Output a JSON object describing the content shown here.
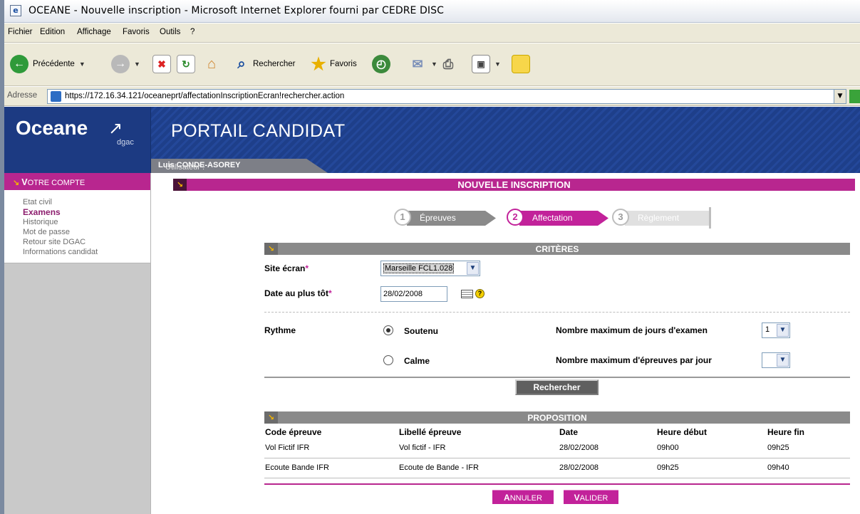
{
  "window": {
    "title": "OCEANE - Nouvelle inscription - Microsoft Internet Explorer fourni par CEDRE DISC"
  },
  "menu": [
    "Fichier",
    "Edition",
    "Affichage",
    "Favoris",
    "Outils",
    "?"
  ],
  "toolbar": {
    "back_label": "Précédente",
    "search_label": "Rechercher",
    "favorites_label": "Favoris"
  },
  "address": {
    "label": "Adresse",
    "url": "https://172.16.34.121/oceaneprt/affectationInscriptionEcran!rechercher.action"
  },
  "brand": {
    "name": "Oceane",
    "sub": "dgac",
    "portal_title": "PORTAIL CANDIDAT"
  },
  "user": {
    "prefix": "Utilisateur : ",
    "name": "Luis CONDE-ASOREY"
  },
  "sidebar": {
    "header_cap": "V",
    "header_rest": "OTRE COMPTE",
    "items": [
      "Etat civil",
      "Examens",
      "Historique",
      "Mot de passe",
      "Retour site DGAC",
      "Informations candidat"
    ]
  },
  "page": {
    "title": "NOUVELLE INSCRIPTION"
  },
  "steps": [
    {
      "num": "1",
      "label": "Épreuves"
    },
    {
      "num": "2",
      "label": "Affectation"
    },
    {
      "num": "3",
      "label": "Règlement"
    }
  ],
  "criteria": {
    "title": "CRITÈRES",
    "site_label": "Site écran",
    "site_value": "Marseille FCL1.028",
    "date_label": "Date au plus tôt",
    "date_value": "28/02/2008",
    "help": "?",
    "rythme_label": "Rythme",
    "rythme_options": [
      "Soutenu",
      "Calme"
    ],
    "max_days_label": "Nombre maximum de jours d'examen",
    "max_days_value": "1",
    "max_tests_label": "Nombre maximum d'épreuves par jour",
    "max_tests_value": "",
    "search_button": "Rechercher"
  },
  "proposition": {
    "title": "PROPOSITION",
    "columns": [
      "Code épreuve",
      "Libellé épreuve",
      "Date",
      "Heure début",
      "Heure fin"
    ],
    "rows": [
      [
        "Vol Fictif IFR",
        "Vol fictif - IFR",
        "28/02/2008",
        "09h00",
        "09h25"
      ],
      [
        "Ecoute Bande IFR",
        "Ecoute de Bande - IFR",
        "28/02/2008",
        "09h25",
        "09h40"
      ]
    ]
  },
  "actions": {
    "cancel_cap": "A",
    "cancel_rest": "NNULER",
    "validate_cap": "V",
    "validate_rest": "ALIDER"
  }
}
